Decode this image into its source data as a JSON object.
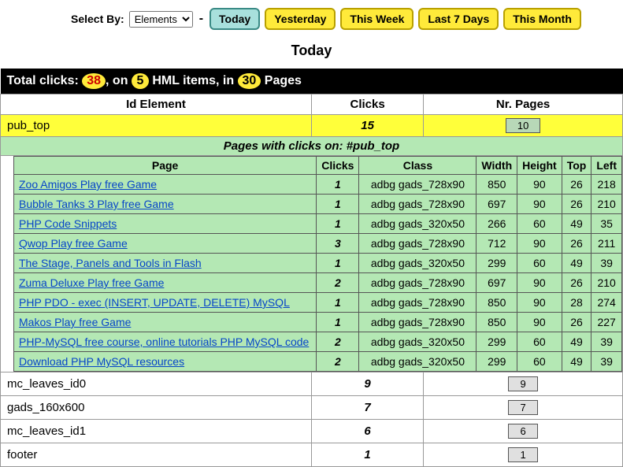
{
  "controls": {
    "select_by_label": "Select By:",
    "select_value": "Elements",
    "today": "Today",
    "yesterday": "Yesterday",
    "this_week": "This Week",
    "last7": "Last 7 Days",
    "this_month": "This Month"
  },
  "heading": "Today",
  "summary": {
    "prefix": "Total clicks: ",
    "clicks": "38",
    "sep1": ", on ",
    "items": "5",
    "sep2": " HML items, in ",
    "pages": "30",
    "suffix": " Pages"
  },
  "headers": {
    "id_element": "Id Element",
    "clicks": "Clicks",
    "nr_pages": "Nr. Pages"
  },
  "selected": {
    "id": "pub_top",
    "clicks": "15",
    "pages": "10"
  },
  "detail_title_prefix": "Pages with clicks on: ",
  "detail_title_id": "#pub_top",
  "detail_headers": {
    "page": "Page",
    "clicks": "Clicks",
    "class": "Class",
    "width": "Width",
    "height": "Height",
    "top": "Top",
    "left": "Left"
  },
  "detail_rows": [
    {
      "page": "Zoo Amigos Play free Game",
      "clicks": "1",
      "class": "adbg gads_728x90",
      "width": "850",
      "height": "90",
      "top": "26",
      "left": "218"
    },
    {
      "page": "Bubble Tanks 3 Play free Game",
      "clicks": "1",
      "class": "adbg gads_728x90",
      "width": "697",
      "height": "90",
      "top": "26",
      "left": "210"
    },
    {
      "page": "PHP Code Snippets",
      "clicks": "1",
      "class": "adbg gads_320x50",
      "width": "266",
      "height": "60",
      "top": "49",
      "left": "35"
    },
    {
      "page": "Qwop Play free Game",
      "clicks": "3",
      "class": "adbg gads_728x90",
      "width": "712",
      "height": "90",
      "top": "26",
      "left": "211"
    },
    {
      "page": "The Stage, Panels and Tools in Flash",
      "clicks": "1",
      "class": "adbg gads_320x50",
      "width": "299",
      "height": "60",
      "top": "49",
      "left": "39"
    },
    {
      "page": "Zuma Deluxe Play free Game",
      "clicks": "2",
      "class": "adbg gads_728x90",
      "width": "697",
      "height": "90",
      "top": "26",
      "left": "210"
    },
    {
      "page": "PHP PDO - exec (INSERT, UPDATE, DELETE) MySQL",
      "clicks": "1",
      "class": "adbg gads_728x90",
      "width": "850",
      "height": "90",
      "top": "28",
      "left": "274"
    },
    {
      "page": "Makos Play free Game",
      "clicks": "1",
      "class": "adbg gads_728x90",
      "width": "850",
      "height": "90",
      "top": "26",
      "left": "227"
    },
    {
      "page": "PHP-MySQL free course, online tutorials PHP MySQL code",
      "clicks": "2",
      "class": "adbg gads_320x50",
      "width": "299",
      "height": "60",
      "top": "49",
      "left": "39"
    },
    {
      "page": "Download PHP MySQL resources",
      "clicks": "2",
      "class": "adbg gads_320x50",
      "width": "299",
      "height": "60",
      "top": "49",
      "left": "39"
    }
  ],
  "other_rows": [
    {
      "id": "mc_leaves_id0",
      "clicks": "9",
      "pages": "9"
    },
    {
      "id": "gads_160x600",
      "clicks": "7",
      "pages": "7"
    },
    {
      "id": "mc_leaves_id1",
      "clicks": "6",
      "pages": "6"
    },
    {
      "id": "footer",
      "clicks": "1",
      "pages": "1"
    }
  ]
}
